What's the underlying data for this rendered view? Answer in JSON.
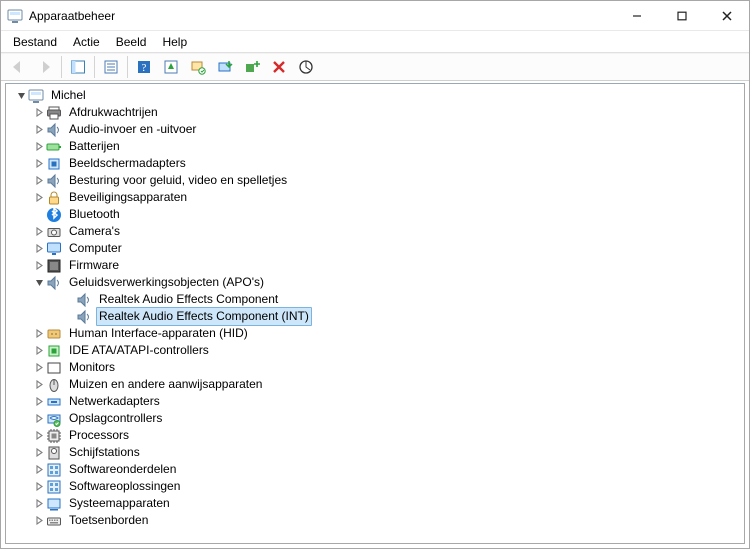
{
  "window": {
    "title": "Apparaatbeheer"
  },
  "menu": {
    "file": "Bestand",
    "action": "Actie",
    "view": "Beeld",
    "help": "Help"
  },
  "root": "Michel",
  "categories": [
    {
      "label": "Afdrukwachtrijen",
      "icon": "printer",
      "expanded": false
    },
    {
      "label": "Audio-invoer en -uitvoer",
      "icon": "speaker",
      "expanded": false
    },
    {
      "label": "Batterijen",
      "icon": "battery",
      "expanded": false
    },
    {
      "label": "Beeldschermadapters",
      "icon": "chip",
      "expanded": false
    },
    {
      "label": "Besturing voor geluid, video en spelletjes",
      "icon": "speaker",
      "expanded": false
    },
    {
      "label": "Beveiligingsapparaten",
      "icon": "lock",
      "expanded": false
    },
    {
      "label": "Bluetooth",
      "icon": "bluetooth",
      "expanded": false,
      "nochev": true
    },
    {
      "label": "Camera's",
      "icon": "camera",
      "expanded": false
    },
    {
      "label": "Computer",
      "icon": "monitor",
      "expanded": false
    },
    {
      "label": "Firmware",
      "icon": "firmware",
      "expanded": false
    },
    {
      "label": "Geluidsverwerkingsobjecten (APO's)",
      "icon": "speaker",
      "expanded": true,
      "children": [
        {
          "label": "Realtek Audio Effects Component",
          "icon": "speaker",
          "selected": false
        },
        {
          "label": "Realtek Audio Effects Component (INT)",
          "icon": "speaker",
          "selected": true
        }
      ]
    },
    {
      "label": "Human Interface-apparaten (HID)",
      "icon": "hid",
      "expanded": false
    },
    {
      "label": "IDE ATA/ATAPI-controllers",
      "icon": "chip-green",
      "expanded": false
    },
    {
      "label": "Monitors",
      "icon": "display",
      "expanded": false
    },
    {
      "label": "Muizen en andere aanwijsapparaten",
      "icon": "mouse",
      "expanded": false
    },
    {
      "label": "Netwerkadapters",
      "icon": "network",
      "expanded": false
    },
    {
      "label": "Opslagcontrollers",
      "icon": "storage",
      "expanded": false
    },
    {
      "label": "Processors",
      "icon": "processor",
      "expanded": false
    },
    {
      "label": "Schijfstations",
      "icon": "disk",
      "expanded": false
    },
    {
      "label": "Softwareonderdelen",
      "icon": "software",
      "expanded": false
    },
    {
      "label": "Softwareoplossingen",
      "icon": "software",
      "expanded": false
    },
    {
      "label": "Systeemapparaten",
      "icon": "system",
      "expanded": false
    },
    {
      "label": "Toetsenborden",
      "icon": "keyboard",
      "expanded": false
    }
  ]
}
